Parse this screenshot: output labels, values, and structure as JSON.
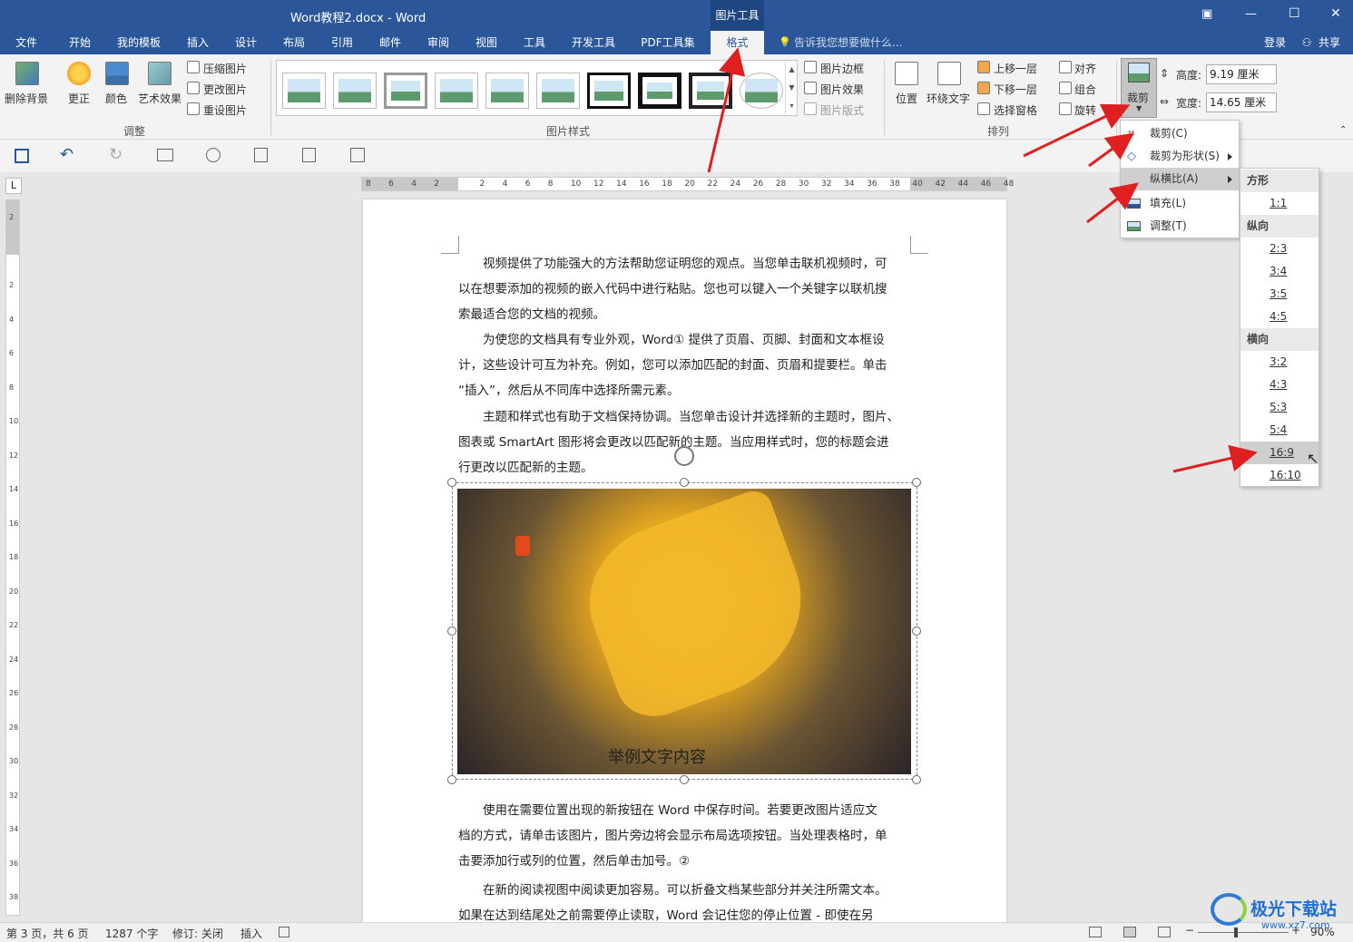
{
  "window": {
    "title": "Word教程2.docx - Word",
    "context_tab_group": "图片工具",
    "controls": {
      "restore": "▣",
      "minimize": "—",
      "maximize": "☐",
      "close": "✕"
    }
  },
  "menubar": {
    "tabs": [
      "文件",
      "开始",
      "我的模板",
      "插入",
      "设计",
      "布局",
      "引用",
      "邮件",
      "审阅",
      "视图",
      "工具",
      "开发工具",
      "PDF工具集",
      "格式"
    ],
    "active_tab": "格式",
    "tell_me": "告诉我您想要做什么...",
    "login": "登录",
    "share": "共享"
  },
  "ribbon": {
    "adjust": {
      "remove_bg": "删除背景",
      "correct": "更正",
      "color": "颜色",
      "artistic": "艺术效果",
      "compress": "压缩图片",
      "change": "更改图片",
      "reset": "重设图片",
      "group_label": "调整"
    },
    "styles": {
      "border": "图片边框",
      "effects": "图片效果",
      "layout": "图片版式",
      "group_label": "图片样式"
    },
    "arrange": {
      "position": "位置",
      "wrap": "环绕文字",
      "forward": "上移一层",
      "backward": "下移一层",
      "selection_pane": "选择窗格",
      "align": "对齐",
      "group": "组合",
      "rotate": "旋转",
      "group_label": "排列"
    },
    "size": {
      "crop": "裁剪",
      "height_label": "高度:",
      "height_value": "9.19 厘米",
      "width_label": "宽度:",
      "width_value": "14.65 厘米"
    }
  },
  "ruler": {
    "h_ticks": [
      "8",
      "6",
      "4",
      "2",
      "",
      "2",
      "4",
      "6",
      "8",
      "10",
      "12",
      "14",
      "16",
      "18",
      "20",
      "22",
      "24",
      "26",
      "28",
      "30",
      "32",
      "34",
      "36",
      "38",
      "40",
      "42",
      "44",
      "46",
      "48"
    ],
    "v_ticks": [
      "2",
      "",
      "2",
      "4",
      "6",
      "8",
      "10",
      "12",
      "14",
      "16",
      "18",
      "20",
      "22",
      "24",
      "26",
      "28",
      "30",
      "32",
      "34",
      "36",
      "38"
    ],
    "corner": "L"
  },
  "document": {
    "p1": [
      "视频提供了功能强大的方法帮助您证明您的观点。当您单击联机视频时，可",
      "以在想要添加的视频的嵌入代码中进行粘贴。您也可以键入一个关键字以联机搜",
      "索最适合您的文档的视频。"
    ],
    "p2": [
      "为使您的文档具有专业外观，Word① 提供了页眉、页脚、封面和文本框设",
      "计，这些设计可互为补充。例如，您可以添加匹配的封面、页眉和提要栏。单击",
      "“插入”，然后从不同库中选择所需元素。"
    ],
    "p3": [
      "主题和样式也有助于文档保持协调。当您单击设计并选择新的主题时，图片、",
      "图表或 SmartArt 图形将会更改以匹配新的主题。当应用样式时，您的标题会进",
      "行更改以匹配新的主题。"
    ],
    "image_caption": "举例文字内容",
    "p4": [
      "使用在需要位置出现的新按钮在 Word 中保存时间。若要更改图片适应文",
      "档的方式，请单击该图片，图片旁边将会显示布局选项按钮。当处理表格时，单",
      "击要添加行或列的位置，然后单击加号。②"
    ],
    "p5": [
      "在新的阅读视图中阅读更加容易。可以折叠文档某些部分并关注所需文本。",
      "如果在达到结尾处之前需要停止读取，Word 会记住您的停止位置 - 即使在另"
    ]
  },
  "crop_menu": {
    "items": [
      "裁剪(C)",
      "裁剪为形状(S)",
      "纵横比(A)",
      "填充(L)",
      "调整(T)"
    ],
    "highlighted": "纵横比(A)"
  },
  "aspect_menu": {
    "square_header": "方形",
    "square": [
      "1:1"
    ],
    "portrait_header": "纵向",
    "portrait": [
      "2:3",
      "3:4",
      "3:5",
      "4:5"
    ],
    "landscape_header": "横向",
    "landscape": [
      "3:2",
      "4:3",
      "5:3",
      "5:4",
      "16:9",
      "16:10"
    ],
    "highlighted": "16:9"
  },
  "statusbar": {
    "page": "第 3 页，共 6 页",
    "words": "1287 个字",
    "track": "修订: 关闭",
    "mode": "插入",
    "zoom": "90%"
  },
  "watermark": {
    "name": "极光下载站",
    "url": "www.xz7.com"
  },
  "colors": {
    "accent": "#2b579a",
    "arrow": "#e02020",
    "menu_highlight": "#cfcfcf"
  }
}
